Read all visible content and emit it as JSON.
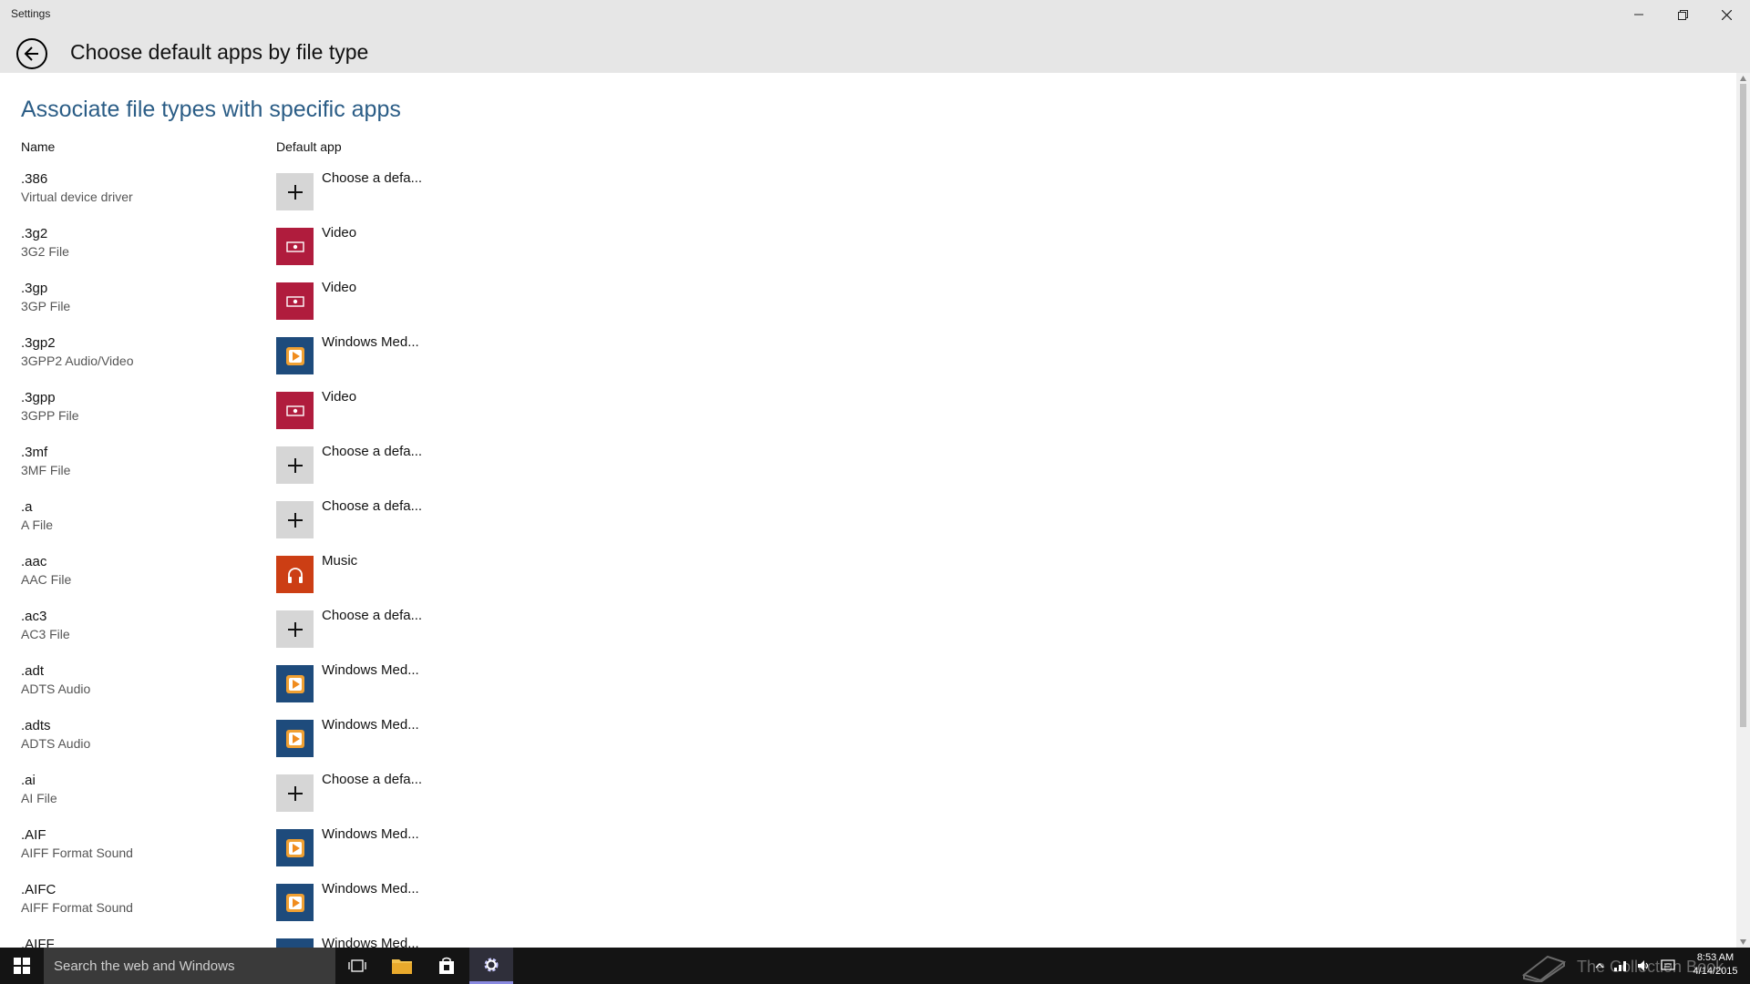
{
  "window": {
    "title": "Settings"
  },
  "header": {
    "page_title": "Choose default apps by file type"
  },
  "main": {
    "section_title": "Associate file types with specific apps",
    "columns": {
      "name": "Name",
      "default_app": "Default app"
    },
    "rows": [
      {
        "ext": ".386",
        "desc": "Virtual device driver",
        "app": "Choose a defa...",
        "icon": "plus-icon"
      },
      {
        "ext": ".3g2",
        "desc": "3G2 File",
        "app": "Video",
        "icon": "video-icon"
      },
      {
        "ext": ".3gp",
        "desc": "3GP File",
        "app": "Video",
        "icon": "video-icon"
      },
      {
        "ext": ".3gp2",
        "desc": "3GPP2 Audio/Video",
        "app": "Windows Med...",
        "icon": "windows-media-player-icon"
      },
      {
        "ext": ".3gpp",
        "desc": "3GPP File",
        "app": "Video",
        "icon": "video-icon"
      },
      {
        "ext": ".3mf",
        "desc": "3MF File",
        "app": "Choose a defa...",
        "icon": "plus-icon"
      },
      {
        "ext": ".a",
        "desc": "A File",
        "app": "Choose a defa...",
        "icon": "plus-icon"
      },
      {
        "ext": ".aac",
        "desc": "AAC File",
        "app": "Music",
        "icon": "music-icon"
      },
      {
        "ext": ".ac3",
        "desc": "AC3 File",
        "app": "Choose a defa...",
        "icon": "plus-icon"
      },
      {
        "ext": ".adt",
        "desc": "ADTS Audio",
        "app": "Windows Med...",
        "icon": "windows-media-player-icon"
      },
      {
        "ext": ".adts",
        "desc": "ADTS Audio",
        "app": "Windows Med...",
        "icon": "windows-media-player-icon"
      },
      {
        "ext": ".ai",
        "desc": "AI File",
        "app": "Choose a defa...",
        "icon": "plus-icon"
      },
      {
        "ext": ".AIF",
        "desc": "AIFF Format Sound",
        "app": "Windows Med...",
        "icon": "windows-media-player-icon"
      },
      {
        "ext": ".AIFC",
        "desc": "AIFF Format Sound",
        "app": "Windows Med...",
        "icon": "windows-media-player-icon"
      },
      {
        "ext": ".AIFF",
        "desc": "",
        "app": "Windows Med...",
        "icon": "windows-media-player-icon"
      }
    ]
  },
  "taskbar": {
    "search_placeholder": "Search the web and Windows",
    "watermark": "The Collection Book",
    "time": "8:53 AM",
    "date": "4/14/2015"
  },
  "colors": {
    "accent_title": "#2b5d86",
    "video_tile": "#b01c3d",
    "wmp_tile": "#1e4b7c",
    "music_tile": "#cc3e14",
    "choose_tile": "#d6d6d6"
  }
}
